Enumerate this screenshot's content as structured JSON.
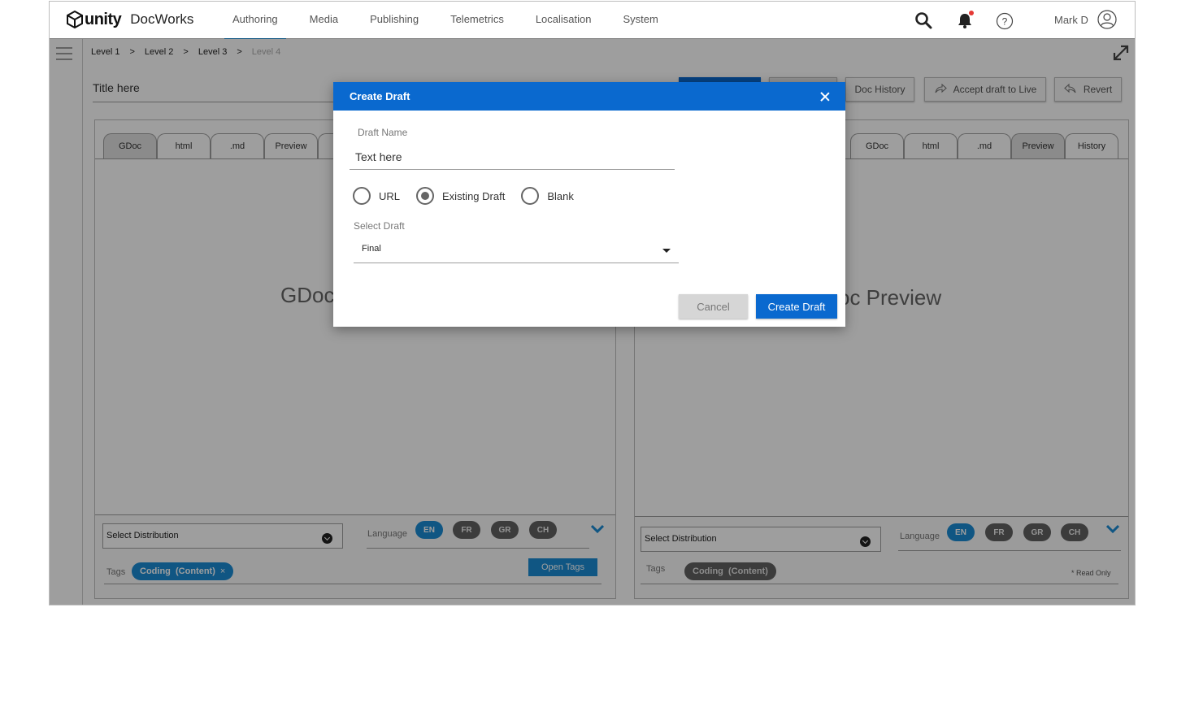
{
  "app": {
    "brand": "unity",
    "product": "DocWorks"
  },
  "nav": {
    "tabs": [
      {
        "label": "Authoring",
        "active": true
      },
      {
        "label": "Media"
      },
      {
        "label": "Publishing"
      },
      {
        "label": "Telemetrics"
      },
      {
        "label": "Localisation"
      },
      {
        "label": "System"
      }
    ],
    "icons": [
      "search-icon",
      "bell-icon",
      "help-icon",
      "user-icon"
    ],
    "user": "Mark D"
  },
  "breadcrumb": {
    "items": [
      "Level 1",
      "Level 2",
      "Level 3"
    ],
    "separator": ">",
    "current": "Level 4"
  },
  "title": "Title here",
  "toolbar": {
    "doc_history": "Doc History",
    "accept": "Accept draft to Live",
    "revert": "Revert"
  },
  "left_panel": {
    "tabs": [
      "GDoc",
      "html",
      ".md",
      "Preview"
    ],
    "active_tab": "GDoc",
    "preview_text": "GDoc",
    "distribution": "Select Distribution",
    "language_label": "Language",
    "languages": [
      "EN",
      "FR",
      "GR",
      "CH"
    ],
    "active_language": "EN",
    "tags_label": "Tags",
    "tag": "Coding  (Content)",
    "tag_remove": "×",
    "open_tags": "Open Tags"
  },
  "right_panel": {
    "tabs": [
      "GDoc",
      "html",
      ".md",
      "Preview",
      "History"
    ],
    "active_tab": "Preview",
    "preview_text": "oc Preview",
    "distribution": "Select Distribution",
    "language_label": "Language",
    "languages": [
      "EN",
      "FR",
      "GR",
      "CH"
    ],
    "active_language": "EN",
    "tags_label": "Tags",
    "tag": "Coding  (Content)",
    "readonly": "* Read Only"
  },
  "modal": {
    "title": "Create Draft",
    "draft_name_label": "Draft Name",
    "draft_name_value": "Text here",
    "options": [
      "URL",
      "Existing Draft",
      "Blank"
    ],
    "selected_option": "Existing Draft",
    "select_draft_label": "Select Draft",
    "select_draft_value": "Final",
    "cancel": "Cancel",
    "create": "Create Draft"
  },
  "colors": {
    "primary": "#0a69cf",
    "accent": "#1a8bd4",
    "pill_grey": "#616161",
    "overlay": "rgba(0,0,0,0.38)"
  }
}
